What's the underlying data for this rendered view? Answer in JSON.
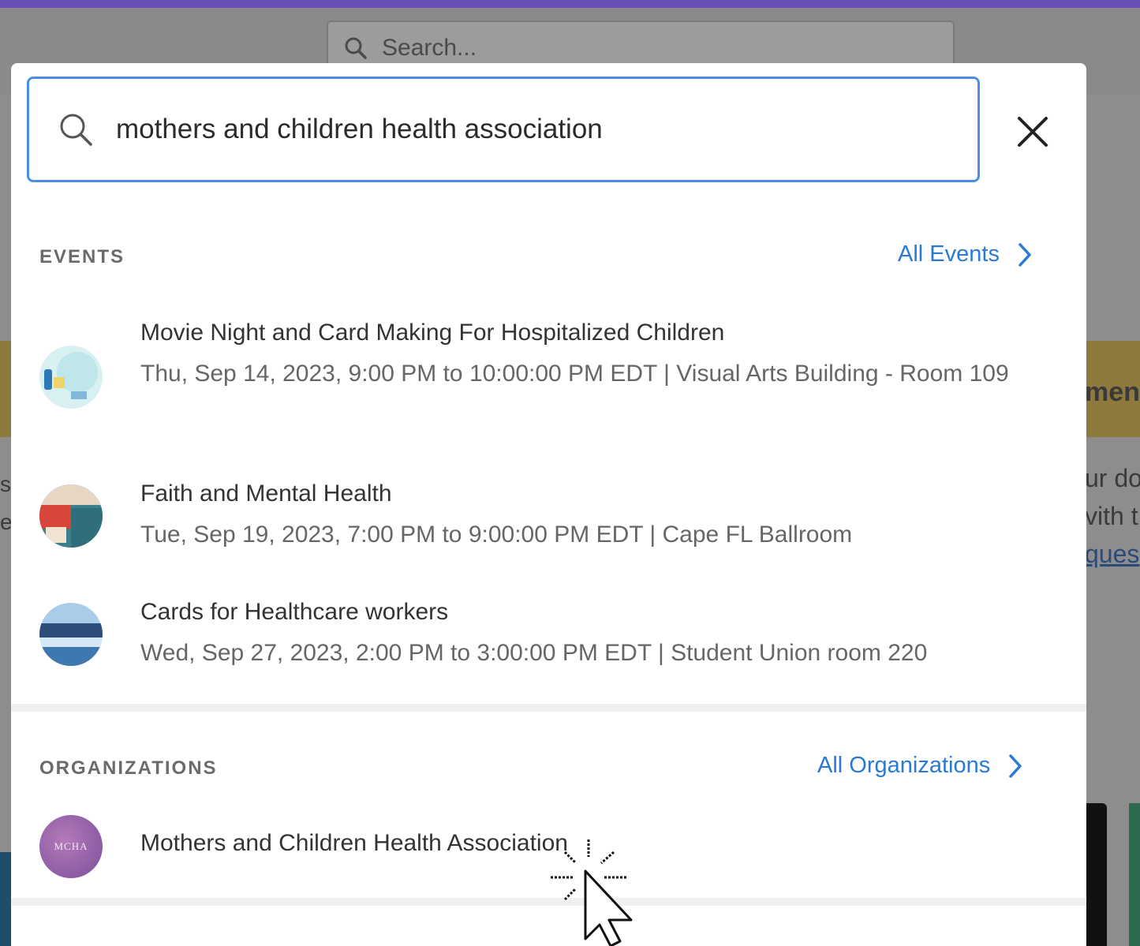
{
  "background": {
    "search_placeholder": "Search...",
    "banner_partial_text": "men",
    "side_text_1": "ur do",
    "side_text_2": "vith t",
    "side_link": "ques",
    "left_marks": [
      "s",
      "e"
    ]
  },
  "search": {
    "value": "mothers and children health association",
    "icon": "search-icon",
    "close_icon": "close-icon"
  },
  "events": {
    "label": "EVENTS",
    "all_link": "All Events",
    "items": [
      {
        "title": "Movie Night and Card Making For Hospitalized Children",
        "meta": "Thu, Sep 14, 2023, 9:00 PM to 10:00:00 PM EDT | Visual Arts Building - Room 109"
      },
      {
        "title": "Faith and Mental Health",
        "meta": "Tue, Sep 19, 2023, 7:00 PM to 9:00:00 PM EDT | Cape FL Ballroom"
      },
      {
        "title": "Cards for Healthcare workers",
        "meta": "Wed, Sep 27, 2023, 2:00 PM to 3:00:00 PM EDT | Student Union room 220"
      }
    ]
  },
  "organizations": {
    "label": "ORGANIZATIONS",
    "all_link": "All Organizations",
    "items": [
      {
        "name": "Mothers and Children Health Association",
        "avatar_text": "MCHA"
      }
    ]
  },
  "colors": {
    "accent": "#2a7ad4",
    "search_border": "#4a90e2",
    "top_bar": "#6a4fb6"
  }
}
